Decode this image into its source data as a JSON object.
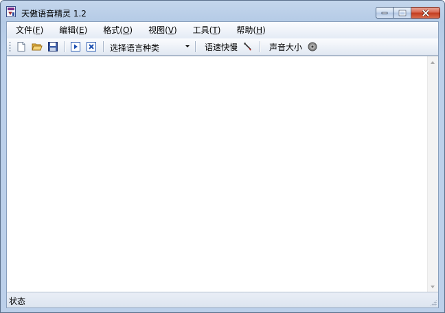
{
  "window": {
    "title": "天傲语音精灵 1.2"
  },
  "menu": [
    {
      "label": "文件(",
      "key": "F",
      "suffix": ")"
    },
    {
      "label": "编辑(",
      "key": "E",
      "suffix": ")"
    },
    {
      "label": "格式(",
      "key": "O",
      "suffix": ")"
    },
    {
      "label": "视图(",
      "key": "V",
      "suffix": ")"
    },
    {
      "label": "工具(",
      "key": "T",
      "suffix": ")"
    },
    {
      "label": "帮助(",
      "key": "H",
      "suffix": ")"
    }
  ],
  "toolbar": {
    "language_select": "选择语言种类",
    "speed_label": "语速快慢",
    "volume_label": "声音大小",
    "icons": [
      "new-file-icon",
      "open-folder-icon",
      "save-icon",
      "play-icon",
      "stop-icon",
      "speed-needle-icon",
      "speaker-icon"
    ]
  },
  "editor": {
    "value": ""
  },
  "status": {
    "text": "状态"
  }
}
